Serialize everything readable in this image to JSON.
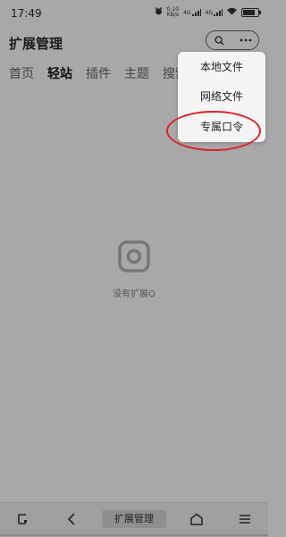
{
  "status_bar": {
    "time": "17:49",
    "net_speed_value": "0.10",
    "net_speed_unit": "KB/s",
    "sim1_label": "4G",
    "sim2_label": "4G",
    "battery_level_percent": 85
  },
  "header": {
    "title": "扩展管理"
  },
  "tabs": [
    {
      "label": "首页"
    },
    {
      "label": "轻站"
    },
    {
      "label": "插件"
    },
    {
      "label": "主题"
    },
    {
      "label": "搜索"
    }
  ],
  "active_tab_index": 1,
  "empty_state": {
    "text": "没有扩展O"
  },
  "menu": {
    "items": [
      {
        "label": "本地文件"
      },
      {
        "label": "网络文件"
      },
      {
        "label": "专属口令"
      }
    ]
  },
  "bottom_bar": {
    "title": "扩展管理"
  },
  "colors": {
    "overlay": "#a8a8a8",
    "menu_background": "#f5f5f5",
    "highlight_annotation": "#d8242a"
  }
}
